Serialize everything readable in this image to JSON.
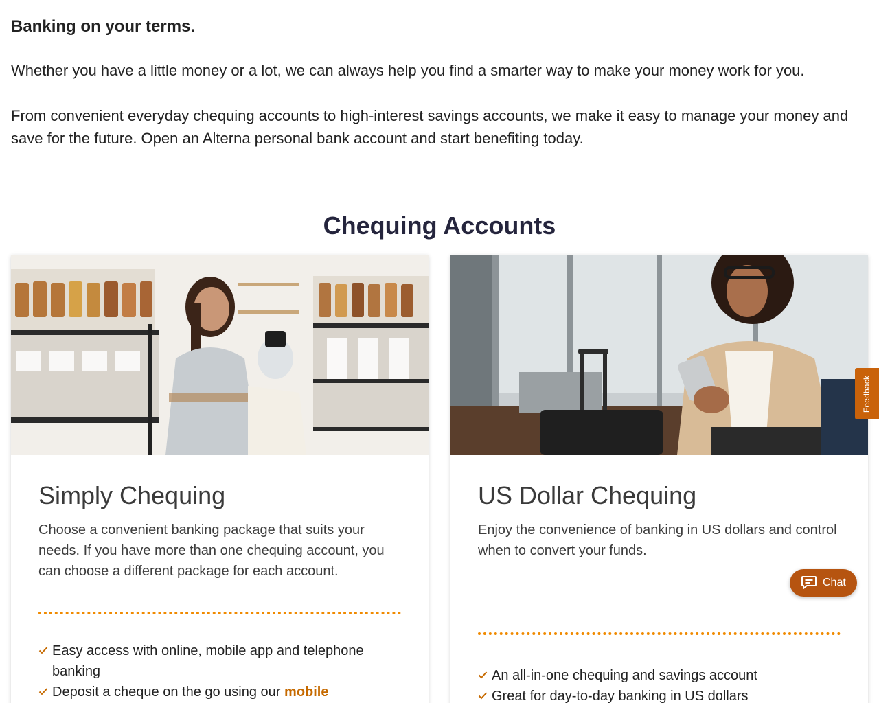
{
  "intro": {
    "heading": "Banking on your terms.",
    "paragraph1": "Whether you have a little money or a lot, we can always help you find a smarter way to make your money work for you.",
    "paragraph2": "From convenient everyday chequing accounts to high-interest savings accounts, we make it easy to manage your money and save for the future. Open an Alterna personal bank account and start benefiting today."
  },
  "section": {
    "title": "Chequing Accounts"
  },
  "cards": [
    {
      "title": "Simply Chequing",
      "description": "Choose a convenient banking package that suits your needs. If you have more than one chequing account, you can choose a different package for each account.",
      "features": [
        {
          "text": "Easy access with online, mobile app and telephone banking"
        },
        {
          "text": "Deposit a cheque on the go using our ",
          "link": "mobile"
        }
      ]
    },
    {
      "title": "US Dollar Chequing",
      "description": "Enjoy the convenience of banking in US dollars and control when to convert your funds.",
      "features": [
        {
          "text": "An all-in-one chequing and savings account"
        },
        {
          "text": "Great for day-to-day banking in US dollars"
        }
      ]
    }
  ],
  "feedback": {
    "label": "Feedback"
  },
  "chat": {
    "label": "Chat"
  },
  "colors": {
    "accent": "#f08a00",
    "link": "#c66a00",
    "chat_bg": "#b65410",
    "feedback_bg": "#c9620a",
    "heading": "#25253d"
  },
  "icons": {
    "check": "check-icon",
    "chat": "chat-bubble-icon"
  }
}
